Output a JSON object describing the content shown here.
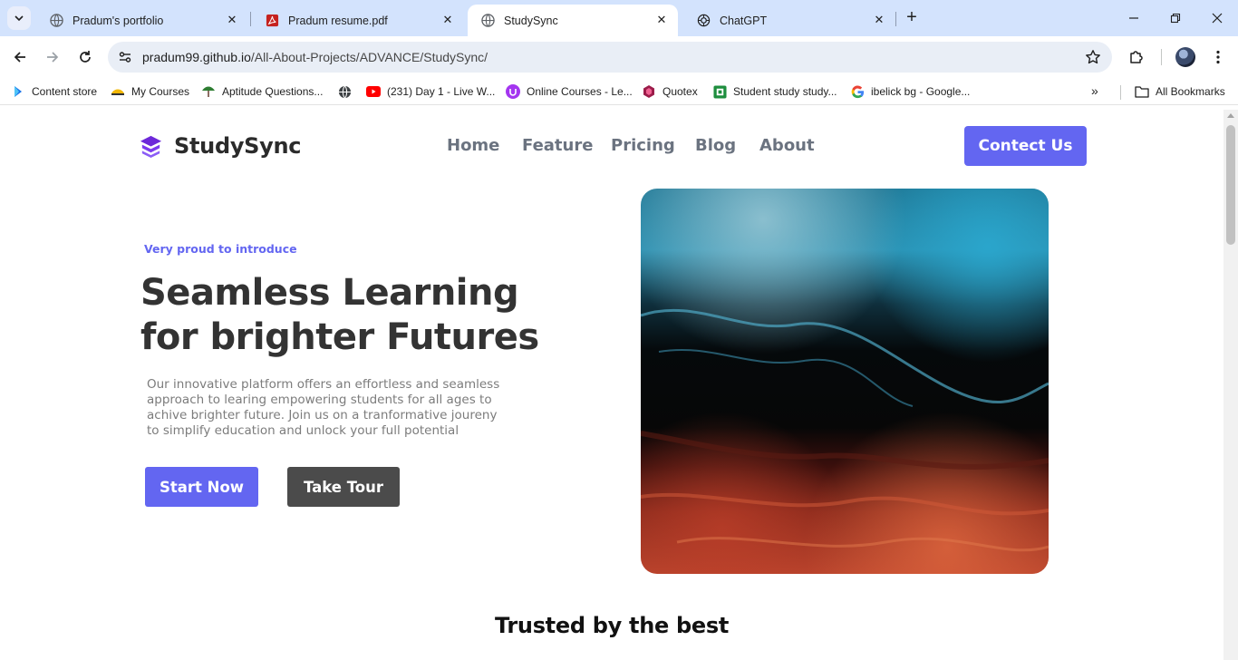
{
  "browser": {
    "tabs": [
      {
        "title": "Pradum's portfolio",
        "icon": "globe-icon",
        "active": false
      },
      {
        "title": "Pradum resume.pdf",
        "icon": "pdf-icon",
        "active": false
      },
      {
        "title": "StudySync",
        "icon": "globe-icon",
        "active": true
      },
      {
        "title": "ChatGPT",
        "icon": "chatgpt-icon",
        "active": false
      }
    ],
    "address": {
      "host": "pradum99.github.io",
      "path": "/All-About-Projects/ADVANCE/StudySync/"
    },
    "bookmarks": [
      {
        "label": "Content store",
        "icon": "content-store-icon"
      },
      {
        "label": "My Courses",
        "icon": "courses-icon"
      },
      {
        "label": "Aptitude Questions...",
        "icon": "aptitude-icon"
      },
      {
        "label": "",
        "icon": "globe-icon"
      },
      {
        "label": "(231) Day 1 - Live W...",
        "icon": "youtube-icon"
      },
      {
        "label": "Online Courses - Le...",
        "icon": "udemy-icon"
      },
      {
        "label": "Quotex",
        "icon": "quotex-icon"
      },
      {
        "label": "Student study study...",
        "icon": "student-study-icon"
      },
      {
        "label": "ibelick bg - Google...",
        "icon": "google-icon"
      }
    ],
    "all_bookmarks_label": "All Bookmarks"
  },
  "site": {
    "brand": "StudySync",
    "nav": [
      "Home",
      "Feature",
      "Pricing",
      "Blog",
      "About"
    ],
    "contact_label": "Contect Us",
    "colors": {
      "accent": "#6366f1",
      "dark_button": "#4b4b4b"
    }
  },
  "hero": {
    "eyebrow": "Very proud to introduce",
    "title": "Seamless Learning for brighter Futures",
    "body": "Our innovative platform offers an effortless and seamless approach to learing empowering students for all ages to achive brighter future. Join us on a tranformative joureny to simplify education and unlock your full potential",
    "primary_cta": "Start Now",
    "secondary_cta": "Take Tour",
    "image": "abstract blue black red fluid art"
  },
  "trusted": {
    "heading": "Trusted by the best"
  }
}
